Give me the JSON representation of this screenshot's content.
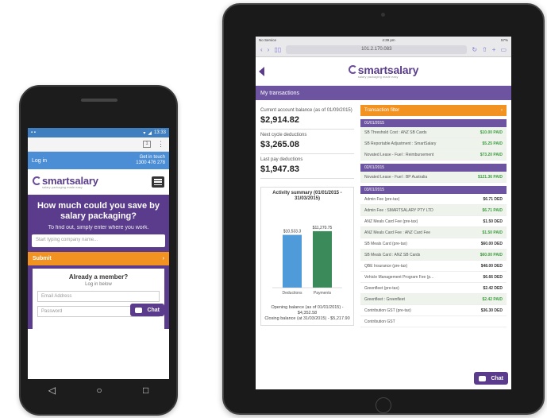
{
  "colors": {
    "brand_purple": "#5b3c8c",
    "accent_orange": "#f29321",
    "login_blue": "#4b8ed6",
    "credit_green": "#3f9b40"
  },
  "brand": {
    "name": "smartsalary",
    "tagline": "salary packaging made easy"
  },
  "phone": {
    "status_time": "13:33",
    "login_label": "Log in",
    "contact_line1": "Get in touch",
    "contact_line2": "1300 476 278",
    "menu_icon": "hamburger-icon",
    "hero_title": "How much could you save by salary packaging?",
    "hero_sub": "To find out, simply enter where you work.",
    "search_placeholder": "Start typing company name...",
    "submit_label": "Submit",
    "member_title": "Already a member?",
    "member_sub": "Log in below",
    "email_placeholder": "Email Address",
    "password_placeholder": "Password",
    "chat_label": "Chat",
    "nav": {
      "back": "◁",
      "home": "○",
      "recents": "□"
    }
  },
  "tablet": {
    "status_carrier": "No Service",
    "status_time": "4:39 pm",
    "status_battery": "57%",
    "url": "101.2.170.083",
    "page_title": "My transactions",
    "stats": [
      {
        "label": "Current account balance (as of 01/09/2015)",
        "value": "$2,914.82"
      },
      {
        "label": "Next cycle deductions",
        "value": "$3,265.08"
      },
      {
        "label": "Last pay deductions",
        "value": "$1,947.83"
      }
    ],
    "summary_title": "Activity summary (01/01/2015 - 31/03/2015)",
    "opening_balance": "Opening balance (as of 01/01/2015) - $4,352.58",
    "closing_balance": "Closing balance (at 31/03/2015) - $5,217.90",
    "filter_label": "Transaction filter",
    "sections": [
      {
        "title": "01/01/2015",
        "rows": [
          {
            "desc": "SB Threshold Cost : ANZ SB Cards",
            "amount": "$10.00 PAID",
            "type": "credit"
          },
          {
            "desc": "SB Reportable Adjustment : SmartSalary",
            "amount": "$5.25 PAID",
            "type": "credit"
          },
          {
            "desc": "Novated Lease - Fuel : Reimbursement",
            "amount": "$73.20 PAID",
            "type": "credit"
          }
        ]
      },
      {
        "title": "02/01/2015",
        "rows": [
          {
            "desc": "Novated Lease - Fuel : BP Australia",
            "amount": "$121.36 PAID",
            "type": "credit"
          }
        ]
      },
      {
        "title": "03/01/2015",
        "rows": [
          {
            "desc": "Admin Fee (pre-tax)",
            "amount": "$6.71 DED",
            "type": "debit"
          },
          {
            "desc": "Admin Fee : SMARTSALARY PTY LTD",
            "amount": "$6.71 PAID",
            "type": "credit"
          },
          {
            "desc": "ANZ Meals Card Fee (pre-tax)",
            "amount": "$1.50 DED",
            "type": "debit"
          },
          {
            "desc": "ANZ Meals Card Fee : ANZ Card Fee",
            "amount": "$1.50 PAID",
            "type": "credit"
          },
          {
            "desc": "SB Meals Card (pre-tax)",
            "amount": "$60.00 DED",
            "type": "debit"
          },
          {
            "desc": "SB Meals Card : ANZ SB Cards",
            "amount": "$60.00 PAID",
            "type": "credit"
          },
          {
            "desc": "QBE Insurance (pre-tax)",
            "amount": "$48.00 DED",
            "type": "debit"
          },
          {
            "desc": "Vehicle Management Program Fee (p...",
            "amount": "$6.66 DED",
            "type": "debit"
          },
          {
            "desc": "Greenfleet (pre-tax)",
            "amount": "$2.42 DED",
            "type": "debit"
          },
          {
            "desc": "Greenfleet : Greenfleet",
            "amount": "$2.42 PAID",
            "type": "credit"
          },
          {
            "desc": "Contribution GST (pre-tax)",
            "amount": "$36.30 DED",
            "type": "debit"
          },
          {
            "desc": "Contribution GST",
            "amount": "",
            "type": "debit"
          }
        ]
      }
    ],
    "chat_label": "Chat"
  },
  "chart_data": {
    "type": "bar",
    "title": "Activity summary (01/01/2015 - 31/03/2015)",
    "categories": [
      "Deductions",
      "Payments"
    ],
    "values": [
      10533.3,
      11270.75
    ],
    "value_labels": [
      "$10,533.3",
      "$11,270.75"
    ],
    "bar_colors": [
      "#4f9bd9",
      "#3b8a5a"
    ],
    "ylim": [
      0,
      13000
    ]
  }
}
